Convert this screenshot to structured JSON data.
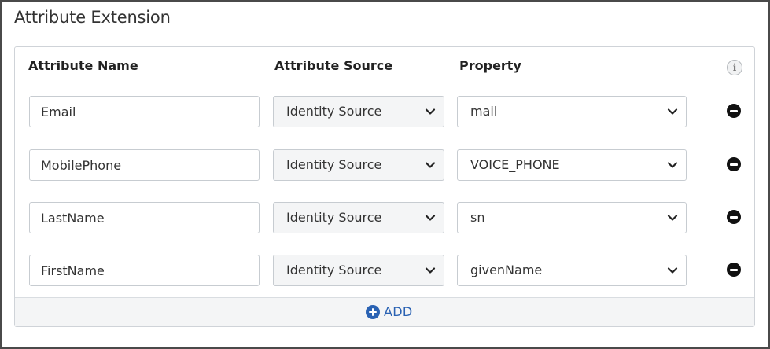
{
  "section": {
    "title": "Attribute Extension"
  },
  "table": {
    "headers": {
      "attribute_name": "Attribute Name",
      "attribute_source": "Attribute Source",
      "property": "Property"
    },
    "rows": [
      {
        "name": "Email",
        "source": "Identity Source",
        "property": "mail"
      },
      {
        "name": "MobilePhone",
        "source": "Identity Source",
        "property": "VOICE_PHONE"
      },
      {
        "name": "LastName",
        "source": "Identity Source",
        "property": "sn"
      },
      {
        "name": "FirstName",
        "source": "Identity Source",
        "property": "givenName"
      }
    ],
    "add_label": "ADD",
    "info_glyph": "i"
  },
  "icons": {
    "info": "info-icon",
    "remove": "minus-circle-icon",
    "add": "plus-circle-icon",
    "dropdown": "chevron-down-icon"
  },
  "colors": {
    "accent": "#2a62b3",
    "border": "#c7ccd1",
    "select_bg": "#f4f5f6"
  }
}
